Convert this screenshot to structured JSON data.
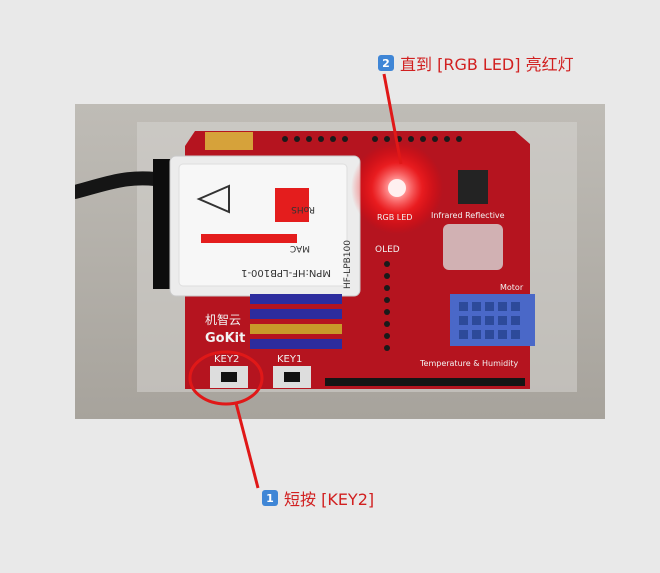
{
  "callouts": {
    "top": {
      "number": "2",
      "text": "直到 [RGB LED] 亮红灯"
    },
    "bottom": {
      "number": "1",
      "text": "短按 [KEY2]"
    }
  },
  "board": {
    "brand_cn": "机智云",
    "brand_en": "GoKit",
    "key2": "KEY2",
    "key1": "KEY1",
    "rgb_led": "RGB LED",
    "infrared": "Infrared Reflective",
    "oled": "OLED",
    "motor": "Motor",
    "temp": "Temperature & Humidity",
    "module_model": "MPN:HF-LPB100-1",
    "module_mac": "MAC",
    "module_side": "HF-LPB100",
    "rohs": "RoHS"
  },
  "colors": {
    "annotation_red": "#e01818",
    "badge_blue": "#3f86d6",
    "board_red": "#b5141f"
  }
}
